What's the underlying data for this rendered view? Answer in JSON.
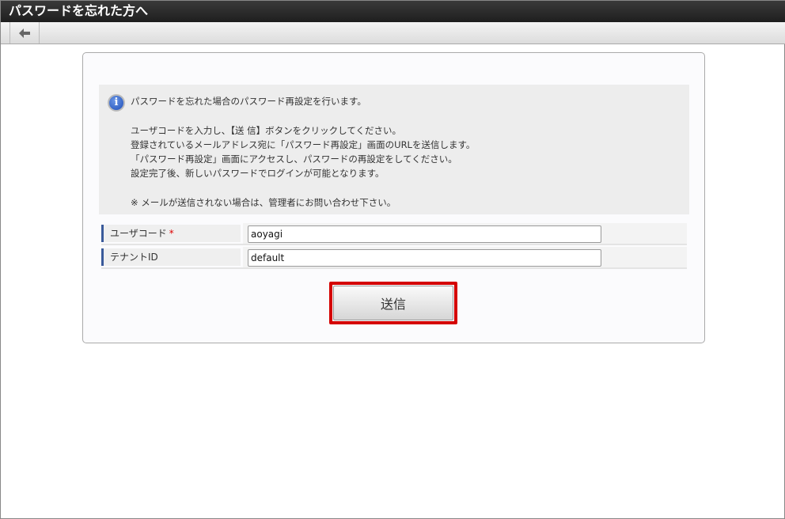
{
  "window": {
    "title": "パスワードを忘れた方へ"
  },
  "toolbar": {
    "back_icon": "arrow-left-icon"
  },
  "info": {
    "icon": "info-icon",
    "lines": [
      "パスワードを忘れた場合のパスワード再設定を行います。",
      "",
      "ユーザコードを入力し、【送 信】ボタンをクリックしてください。",
      "登録されているメールアドレス宛に「パスワード再設定」画面のURLを送信します。",
      "「パスワード再設定」画面にアクセスし、パスワードの再設定をしてください。",
      "設定完了後、新しいパスワードでログインが可能となります。",
      "",
      "※ メールが送信されない場合は、管理者にお問い合わせ下さい。"
    ]
  },
  "form": {
    "user_code": {
      "label": "ユーザコード",
      "required_mark": "*",
      "value": "aoyagi"
    },
    "tenant_id": {
      "label": "テナントID",
      "value": "default"
    },
    "submit_label": "送信"
  }
}
